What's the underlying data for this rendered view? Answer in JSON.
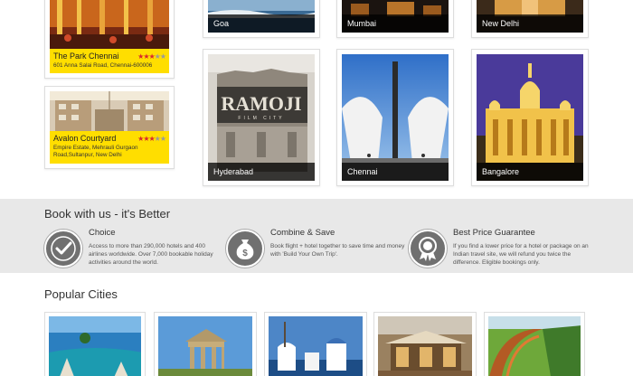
{
  "hotels": [
    {
      "name": "The Park Chennai",
      "address": "601 Anna Salai Road, Chennai-600006",
      "rating": 3,
      "max_rating": 5
    },
    {
      "name": "Avalon Courtyard",
      "address": "Empire Estate, Mehrauli Gurgaon Road,Sultanpur, New Delhi",
      "rating": 3,
      "max_rating": 5
    }
  ],
  "destinations": {
    "top_row": [
      "Goa",
      "Mumbai",
      "New Delhi"
    ],
    "bottom_row": [
      "Hyderabad",
      "Chennai",
      "Bangalore"
    ]
  },
  "book_section": {
    "title": "Book with us - it's Better",
    "features": [
      {
        "title": "Choice",
        "text": "Access to more than 290,000 hotels and 400 airlines worldwide. Over 7,000 bookable holiday activities around the world.",
        "icon": "checkmark-icon"
      },
      {
        "title": "Combine & Save",
        "text": "Book flight + hotel together to save time and money with 'Build Your Own Trip'.",
        "icon": "money-bag-icon"
      },
      {
        "title": "Best Price Guarantee",
        "text": "If you find a lower price for a hotel or package on an Indian travel site, we will refund you twice the difference. Eligible bookings only.",
        "icon": "award-badge-icon"
      }
    ]
  },
  "popular_cities": {
    "title": "Popular Cities"
  },
  "colors": {
    "caption_bg": "#ffde00",
    "star_on": "#d9262c",
    "band_bg": "#e8e8e8"
  }
}
